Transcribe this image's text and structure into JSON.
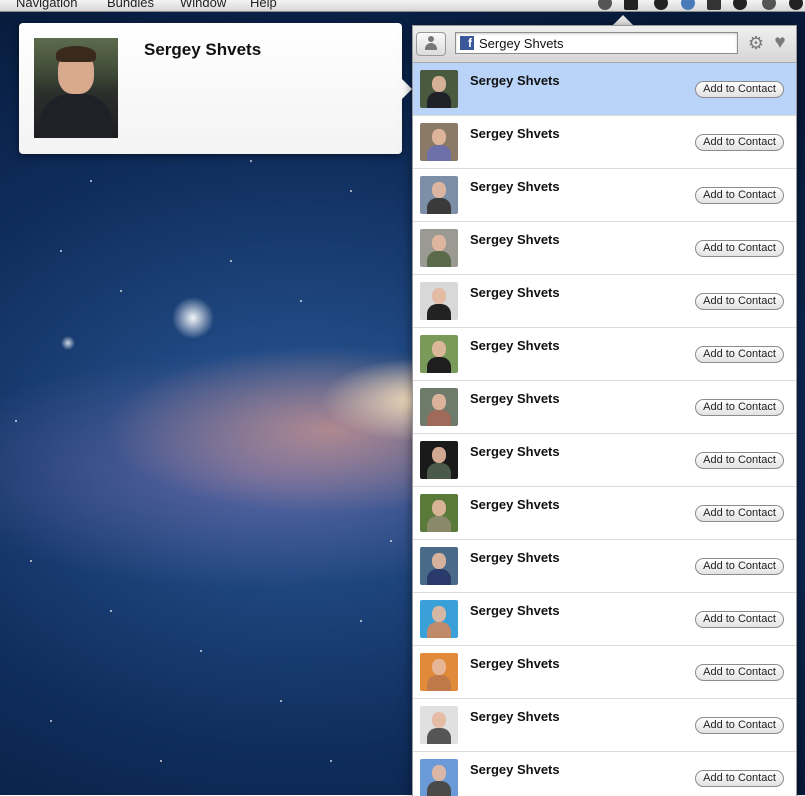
{
  "menubar": {
    "items": [
      "Navigation",
      "Bundles",
      "Window",
      "Help"
    ]
  },
  "profile": {
    "name": "Sergey Shvets"
  },
  "search": {
    "value": "Sergey Shvets",
    "source_icon": "facebook-icon"
  },
  "toolbar": {
    "back_icon": "person-icon",
    "settings_icon": "gear-icon",
    "favorites_icon": "heart-icon"
  },
  "contacts": [
    {
      "name": "Sergey Shvets",
      "button": "Add to Contact",
      "selected": true,
      "bg": "#4a5a3e",
      "shirt": "#1f2028"
    },
    {
      "name": "Sergey Shvets",
      "button": "Add to Contact",
      "selected": false,
      "bg": "#8a7a66",
      "shirt": "#6d6fa8"
    },
    {
      "name": "Sergey Shvets",
      "button": "Add to Contact",
      "selected": false,
      "bg": "#7d8fa6",
      "shirt": "#3a3a3a"
    },
    {
      "name": "Sergey Shvets",
      "button": "Add to Contact",
      "selected": false,
      "bg": "#9a9a92",
      "shirt": "#5a6a4a"
    },
    {
      "name": "Sergey Shvets",
      "button": "Add to Contact",
      "selected": false,
      "bg": "#d8d8d8",
      "shirt": "#222222"
    },
    {
      "name": "Sergey Shvets",
      "button": "Add to Contact",
      "selected": false,
      "bg": "#7a9a5a",
      "shirt": "#1e1e1e"
    },
    {
      "name": "Sergey Shvets",
      "button": "Add to Contact",
      "selected": false,
      "bg": "#6e7a6a",
      "shirt": "#a06a5a"
    },
    {
      "name": "Sergey Shvets",
      "button": "Add to Contact",
      "selected": false,
      "bg": "#1a1a1a",
      "shirt": "#4a5a4a"
    },
    {
      "name": "Sergey Shvets",
      "button": "Add to Contact",
      "selected": false,
      "bg": "#5a7a3a",
      "shirt": "#8a8a6a"
    },
    {
      "name": "Sergey Shvets",
      "button": "Add to Contact",
      "selected": false,
      "bg": "#4a6a8a",
      "shirt": "#2a3a6a"
    },
    {
      "name": "Sergey Shvets",
      "button": "Add to Contact",
      "selected": false,
      "bg": "#3aa0d8",
      "shirt": "#c08a6a"
    },
    {
      "name": "Sergey Shvets",
      "button": "Add to Contact",
      "selected": false,
      "bg": "#e08a3a",
      "shirt": "#c07a4a"
    },
    {
      "name": "Sergey Shvets",
      "button": "Add to Contact",
      "selected": false,
      "bg": "#e0e0e0",
      "shirt": "#555555"
    },
    {
      "name": "Sergey Shvets",
      "button": "Add to Contact",
      "selected": false,
      "bg": "#6a9ad8",
      "shirt": "#4a4a4a"
    }
  ]
}
